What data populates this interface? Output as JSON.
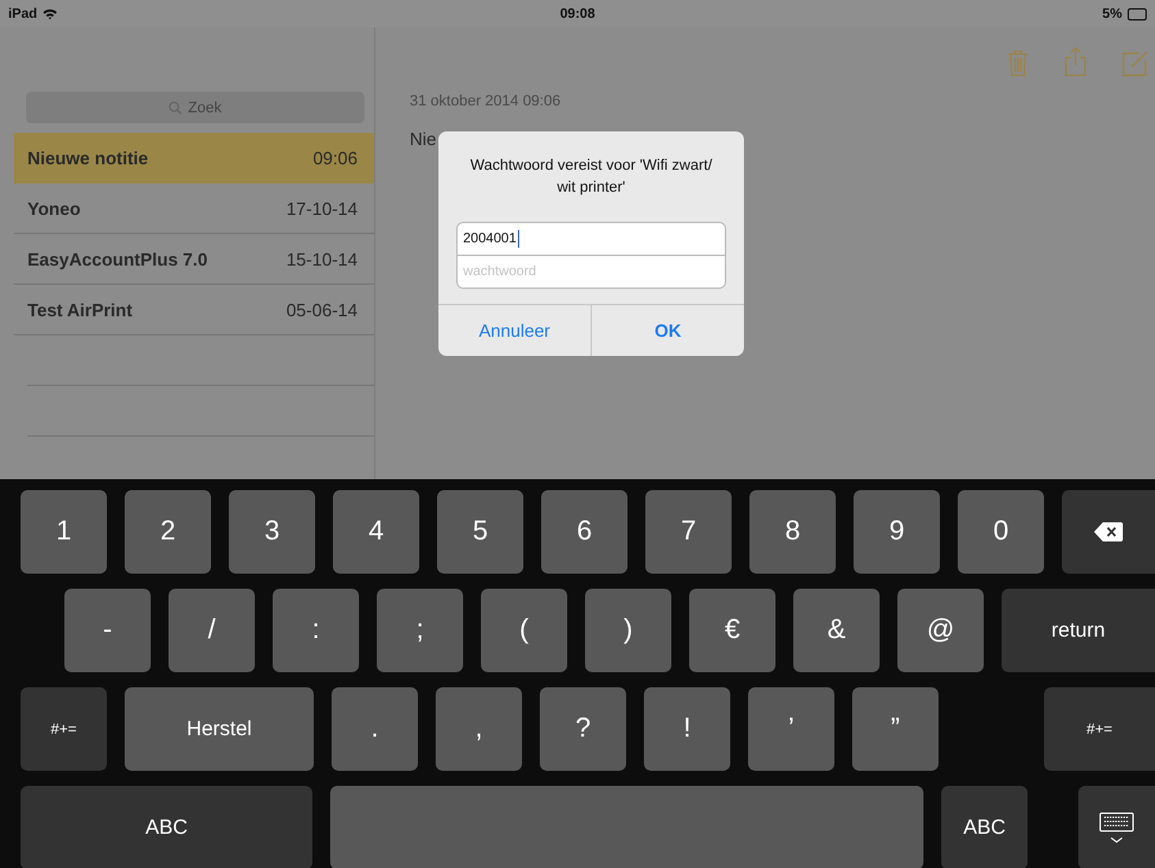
{
  "status_bar": {
    "device": "iPad",
    "time": "09:08",
    "battery": "5%"
  },
  "sidebar": {
    "search": {
      "placeholder": "Zoek"
    },
    "notes": [
      {
        "title": "Nieuwe notitie",
        "date": "09:06",
        "selected": true
      },
      {
        "title": "Yoneo",
        "date": "17-10-14",
        "selected": false
      },
      {
        "title": "EasyAccountPlus 7.0",
        "date": "15-10-14",
        "selected": false
      },
      {
        "title": "Test AirPrint",
        "date": "05-06-14",
        "selected": false
      }
    ]
  },
  "note": {
    "date": "31 oktober 2014 09:06",
    "body": "Nie"
  },
  "dialog": {
    "message": "Wachtwoord vereist voor 'Wifi zwart/ wit printer'",
    "fields": [
      {
        "value": "2004001"
      },
      {
        "placeholder": "wachtwoord"
      }
    ],
    "buttons": [
      {
        "label": "Annuleer",
        "kind": "cancel"
      },
      {
        "label": "OK",
        "kind": "default"
      }
    ]
  },
  "keyboard": {
    "rows": [
      [
        {
          "label": "1",
          "kind": "char"
        },
        {
          "label": "2",
          "kind": "char"
        },
        {
          "label": "3",
          "kind": "char"
        },
        {
          "label": "4",
          "kind": "char"
        },
        {
          "label": "5",
          "kind": "char"
        },
        {
          "label": "6",
          "kind": "char"
        },
        {
          "label": "7",
          "kind": "char"
        },
        {
          "label": "8",
          "kind": "char"
        },
        {
          "label": "9",
          "kind": "char"
        },
        {
          "label": "0",
          "kind": "char"
        },
        {
          "kind": "delete"
        }
      ],
      [
        {
          "label": "-",
          "kind": "char"
        },
        {
          "label": "/",
          "kind": "char"
        },
        {
          "label": ":",
          "kind": "char"
        },
        {
          "label": ";",
          "kind": "char"
        },
        {
          "label": "(",
          "kind": "char"
        },
        {
          "label": ")",
          "kind": "char"
        },
        {
          "label": "€",
          "kind": "char"
        },
        {
          "label": "&",
          "kind": "char"
        },
        {
          "label": "@",
          "kind": "char"
        },
        {
          "label": "return",
          "kind": "return"
        }
      ],
      [
        {
          "label": "#+=",
          "kind": "symbols"
        },
        {
          "label": "Herstel",
          "kind": "undo"
        },
        {
          "label": ".",
          "kind": "char"
        },
        {
          "label": ",",
          "kind": "char"
        },
        {
          "label": "?",
          "kind": "char"
        },
        {
          "label": "!",
          "kind": "char"
        },
        {
          "label": "’",
          "kind": "char"
        },
        {
          "label": "”",
          "kind": "char"
        },
        {
          "label": "#+=",
          "kind": "symbols"
        }
      ],
      [
        {
          "label": "ABC",
          "kind": "abc"
        },
        {
          "kind": "space"
        },
        {
          "label": "ABC",
          "kind": "abc"
        },
        {
          "kind": "hide"
        }
      ]
    ]
  }
}
